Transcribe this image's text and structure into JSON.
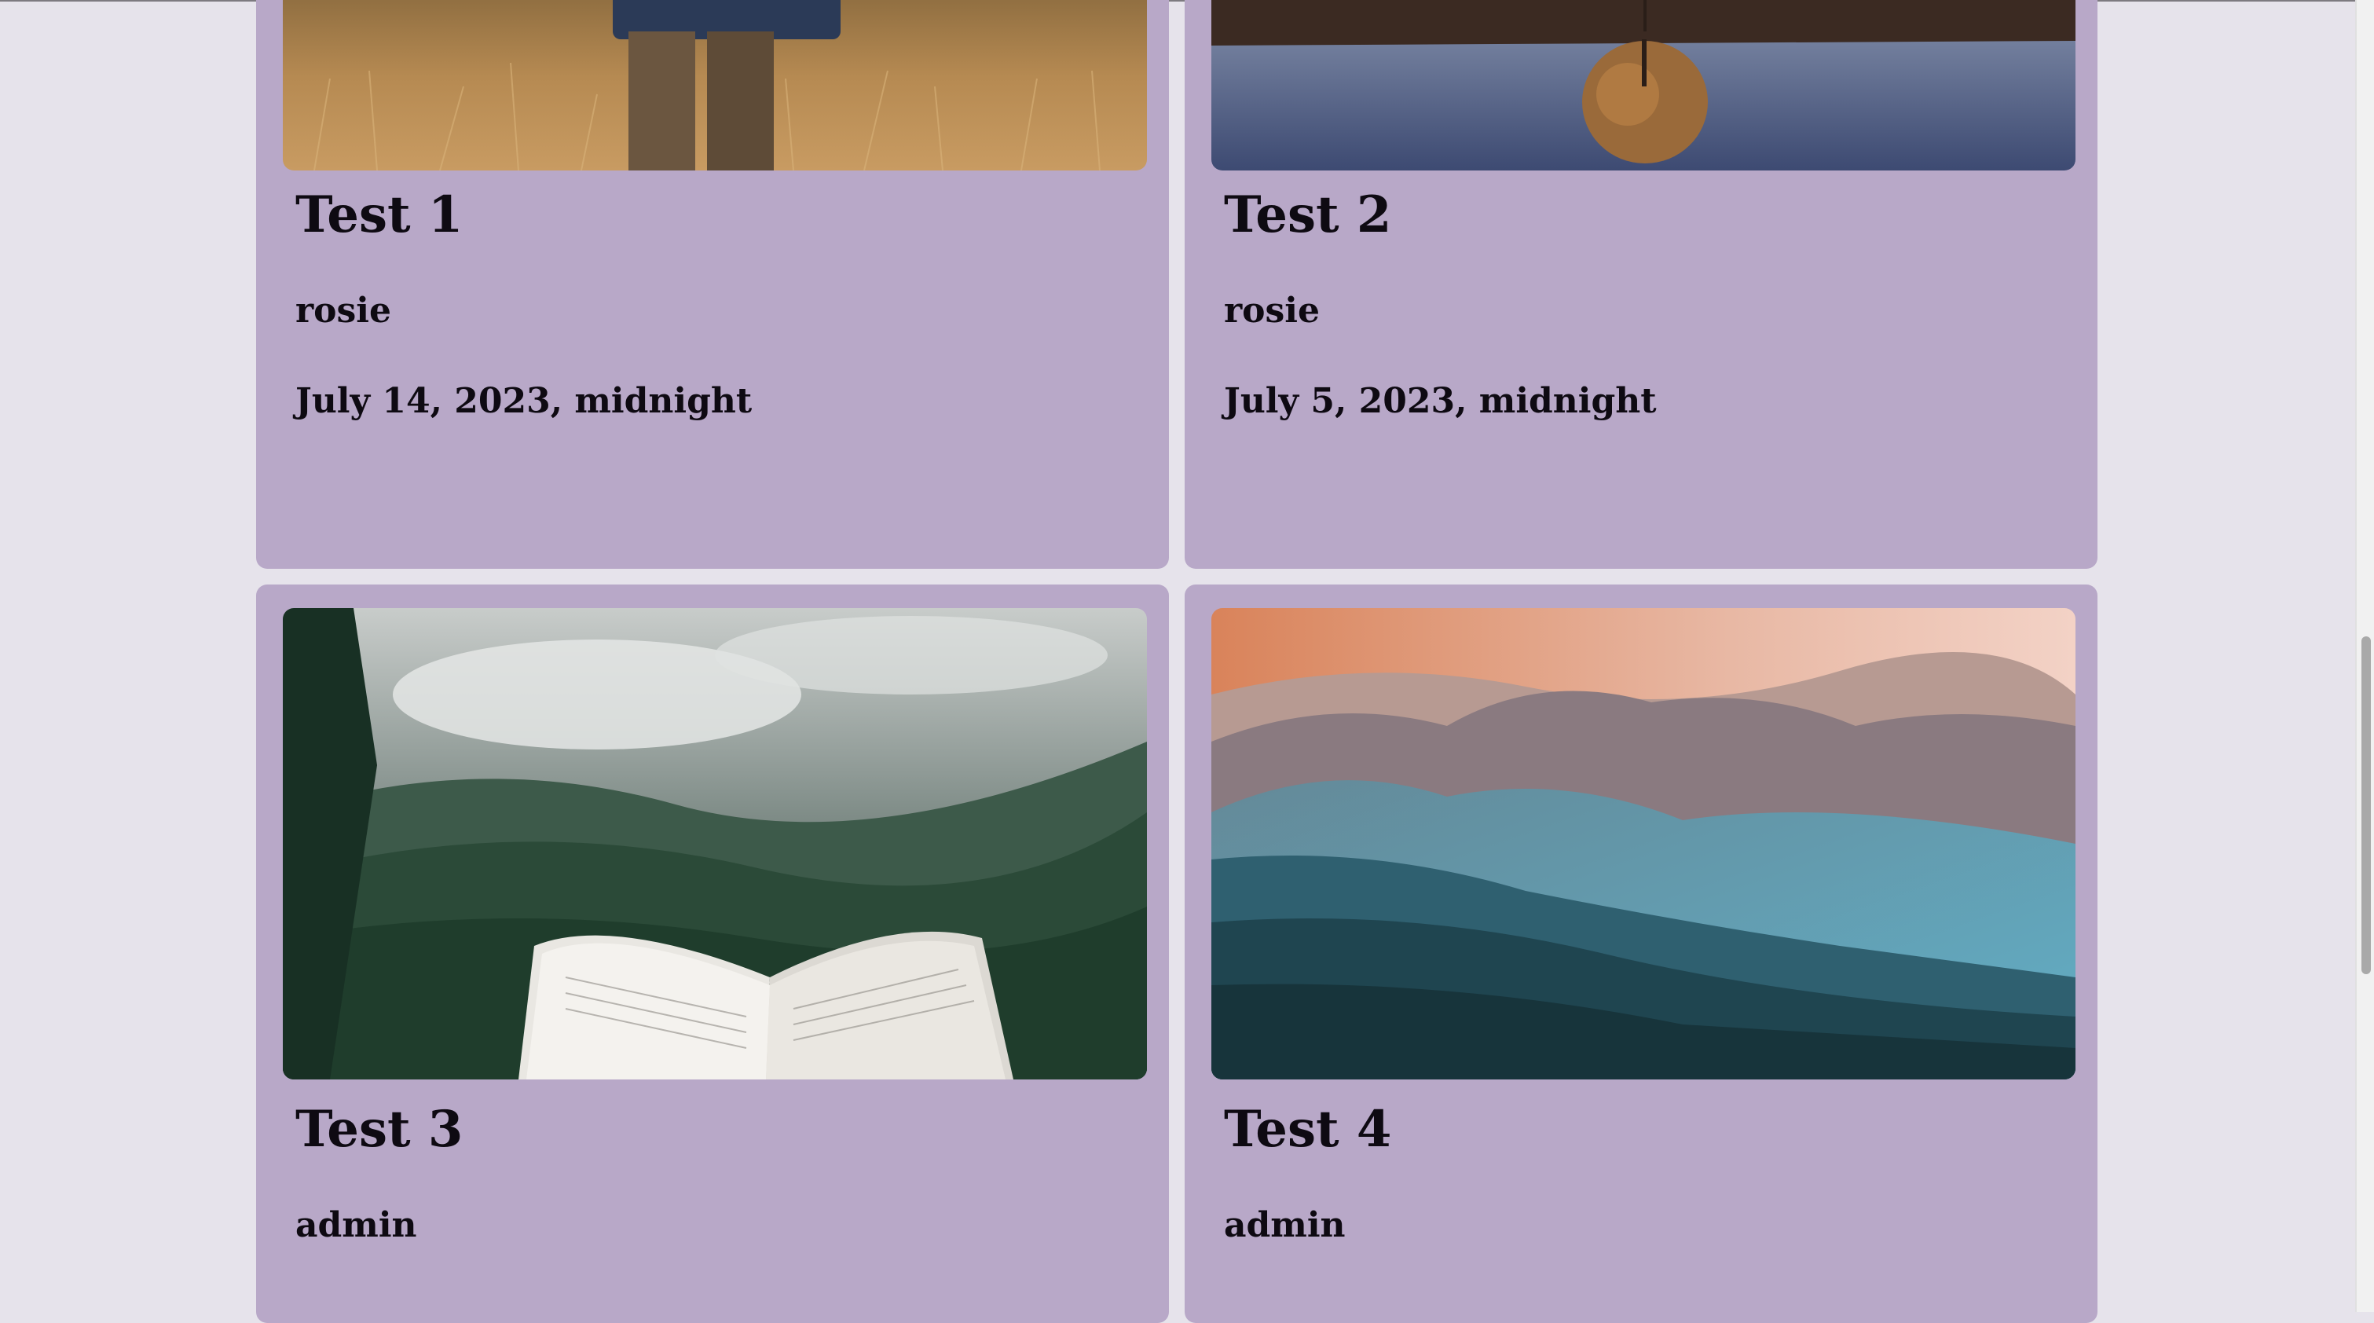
{
  "posts": [
    {
      "title": "Test 1",
      "author": "rosie",
      "date": "July 14, 2023, midnight",
      "image": "person-in-wheat-field"
    },
    {
      "title": "Test 2",
      "author": "rosie",
      "date": "July 5, 2023, midnight",
      "image": "tree-reflection-lake"
    },
    {
      "title": "Test 3",
      "author": "admin",
      "image": "open-book-forest-mountains"
    },
    {
      "title": "Test 4",
      "author": "admin",
      "image": "misty-mountain-range"
    }
  ],
  "colors": {
    "page_bg": "#e6e3eb",
    "card_bg": "#b8a8c8",
    "text": "#0e0a12"
  }
}
